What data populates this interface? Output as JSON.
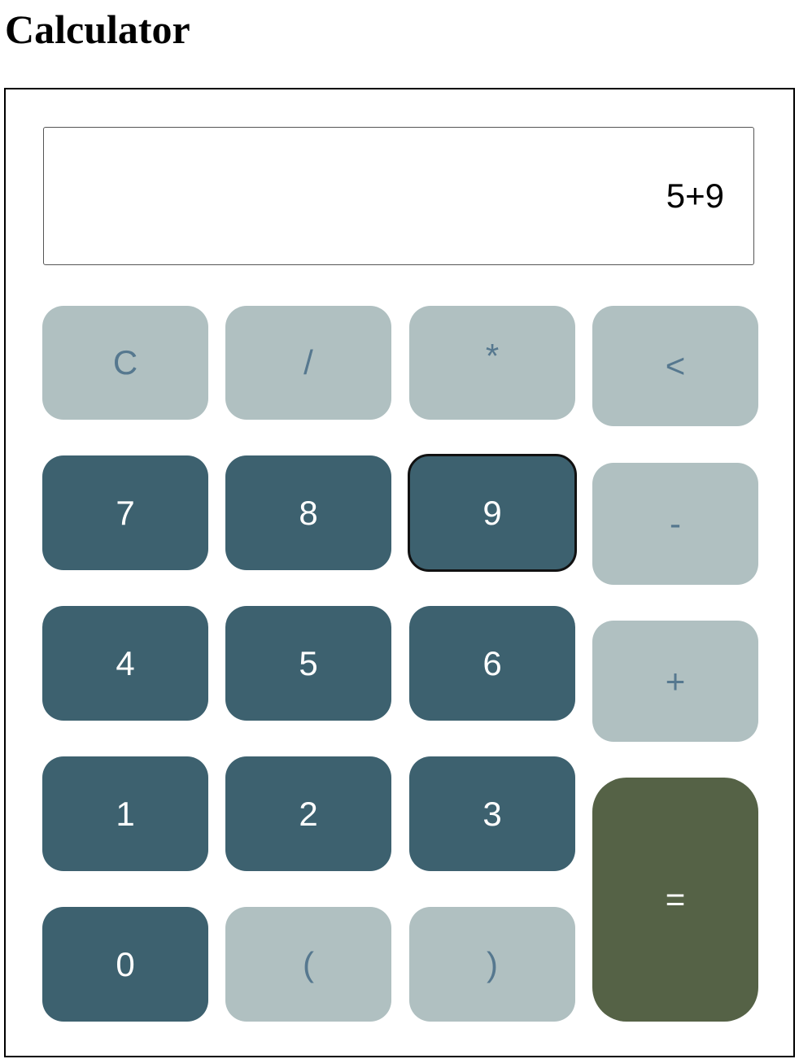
{
  "page": {
    "title": "Calculator"
  },
  "display": {
    "value": "5+9"
  },
  "keys": {
    "clear": "C",
    "divide": "/",
    "multiply": "*",
    "backspace": "<",
    "seven": "7",
    "eight": "8",
    "nine": "9",
    "minus": "-",
    "four": "4",
    "five": "5",
    "six": "6",
    "plus": "+",
    "one": "1",
    "two": "2",
    "three": "3",
    "equals": "=",
    "zero": "0",
    "open_paren": "(",
    "close_paren": ")"
  },
  "colors": {
    "number_key": "#3d616f",
    "operator_key": "#b0c0c1",
    "operator_text": "#56788f",
    "equals_key": "#556246"
  }
}
